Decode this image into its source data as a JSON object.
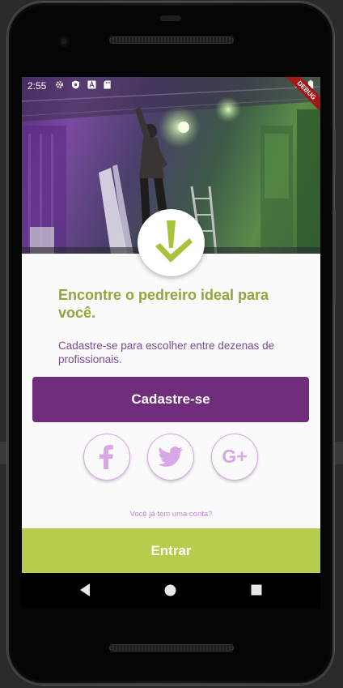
{
  "status_bar": {
    "time": "2:55",
    "icons": [
      "settings-icon",
      "shield-icon",
      "a-icon",
      "sd-card-icon",
      "wifi-icon",
      "battery-icon"
    ]
  },
  "debug_banner": "DEBUG",
  "hero": {
    "image": "construction-worker-photo",
    "logo_icon": "checkmark-drop-logo"
  },
  "headline": "Encontre o pedreiro ideal para você.",
  "subtext": "Cadastre-se para escolher entre dezenas de profissionais.",
  "signup_button": "Cadastre-se",
  "social": {
    "facebook_icon": "facebook-icon",
    "twitter_icon": "twitter-icon",
    "google_icon": "google-plus-icon",
    "google_label": "G+"
  },
  "have_account": "Você já tem uma conta?",
  "enter_button": "Entrar",
  "nav": {
    "back": "back-icon",
    "home": "home-icon",
    "recents": "recents-icon"
  },
  "colors": {
    "brand_purple": "#6f2d7b",
    "brand_green": "#b6cc4c",
    "headline_green": "#8fa83e",
    "subtext_purple": "#7d4c94",
    "social_icon": "#d9a6e6"
  }
}
